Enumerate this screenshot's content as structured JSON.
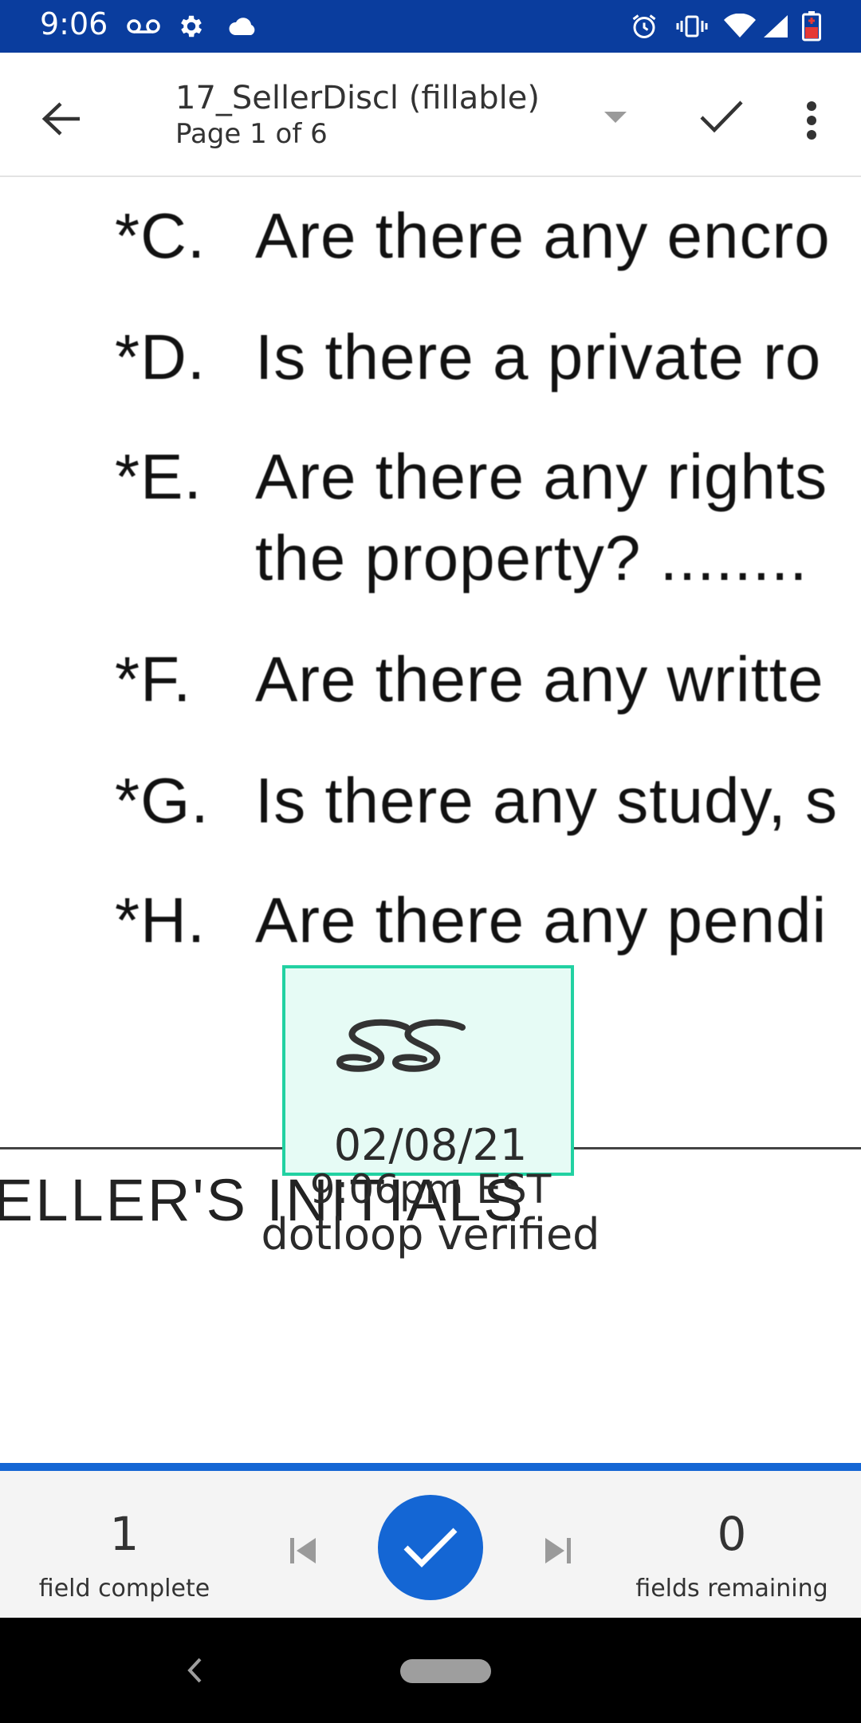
{
  "status_bar": {
    "time": "9:06",
    "icons": [
      "voicemail-icon",
      "settings-gear-icon",
      "cloud-icon",
      "alarm-icon",
      "vibrate-icon",
      "wifi-icon",
      "signal-icon",
      "battery-low-icon"
    ],
    "background": "#0a3d9e"
  },
  "app_bar": {
    "title": "17_SellerDiscl (fillable)",
    "subtitle": "Page 1 of 6"
  },
  "document": {
    "questions": [
      {
        "label": "*C.",
        "text": "Are there any encro"
      },
      {
        "label": "*D.",
        "text": "Is there a private ro"
      },
      {
        "label": "*E.",
        "text": "Are there any rights"
      },
      {
        "label": "",
        "text": "the property?  ........"
      },
      {
        "label": "*F.",
        "text": "Are there any writte"
      },
      {
        "label": "*G.",
        "text": "Is there any study, s"
      },
      {
        "label": "*H.",
        "text": "Are there any pendi"
      }
    ],
    "sellers_initials_label": "ELLER'S INITIALS",
    "signature": {
      "initials": "SS",
      "date": "02/08/21",
      "time": "9:06pm EST",
      "verified": "dotloop verified"
    }
  },
  "field_bar": {
    "complete_count": "1",
    "complete_label": "field complete",
    "remaining_count": "0",
    "remaining_label": "fields remaining",
    "accent": "#1466d4"
  }
}
